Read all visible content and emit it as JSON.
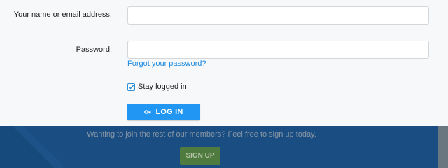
{
  "login": {
    "name_label": "Your name or email address:",
    "name_value": "",
    "password_label": "Password:",
    "password_value": "",
    "forgot_link": "Forgot your password?",
    "remember_label": "Stay logged in",
    "remember_checked": true,
    "login_button": "LOG IN",
    "login_icon": "key-icon"
  },
  "signup": {
    "text": "Wanting to join the rest of our members? Feel free to sign up today.",
    "button": "SIGN UP"
  },
  "colors": {
    "primary": "#2196f3",
    "link": "#1c8ae1",
    "footer": "#1a4e83",
    "signup_button": "#4f7b3f"
  }
}
